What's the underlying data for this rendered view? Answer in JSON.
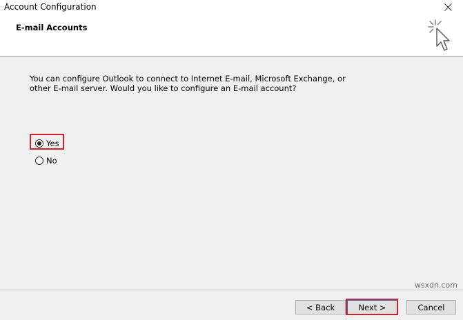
{
  "window": {
    "title": "Account Configuration"
  },
  "header": {
    "heading": "E-mail Accounts",
    "icon": "wizard-cursor-icon"
  },
  "body": {
    "description_line1": "You can configure Outlook to connect to Internet E-mail, Microsoft Exchange, or",
    "description_line2": "other E-mail server. Would you like to configure an E-mail account?",
    "options": [
      {
        "label": "Yes",
        "selected": true
      },
      {
        "label": "No",
        "selected": false
      }
    ]
  },
  "footer": {
    "back_label": "< Back",
    "next_label": "Next >",
    "cancel_label": "Cancel"
  },
  "watermark": "wsxdn.com",
  "colors": {
    "highlight": "#d0202a",
    "background": "#f0f0f0",
    "header_background": "#ffffff"
  }
}
